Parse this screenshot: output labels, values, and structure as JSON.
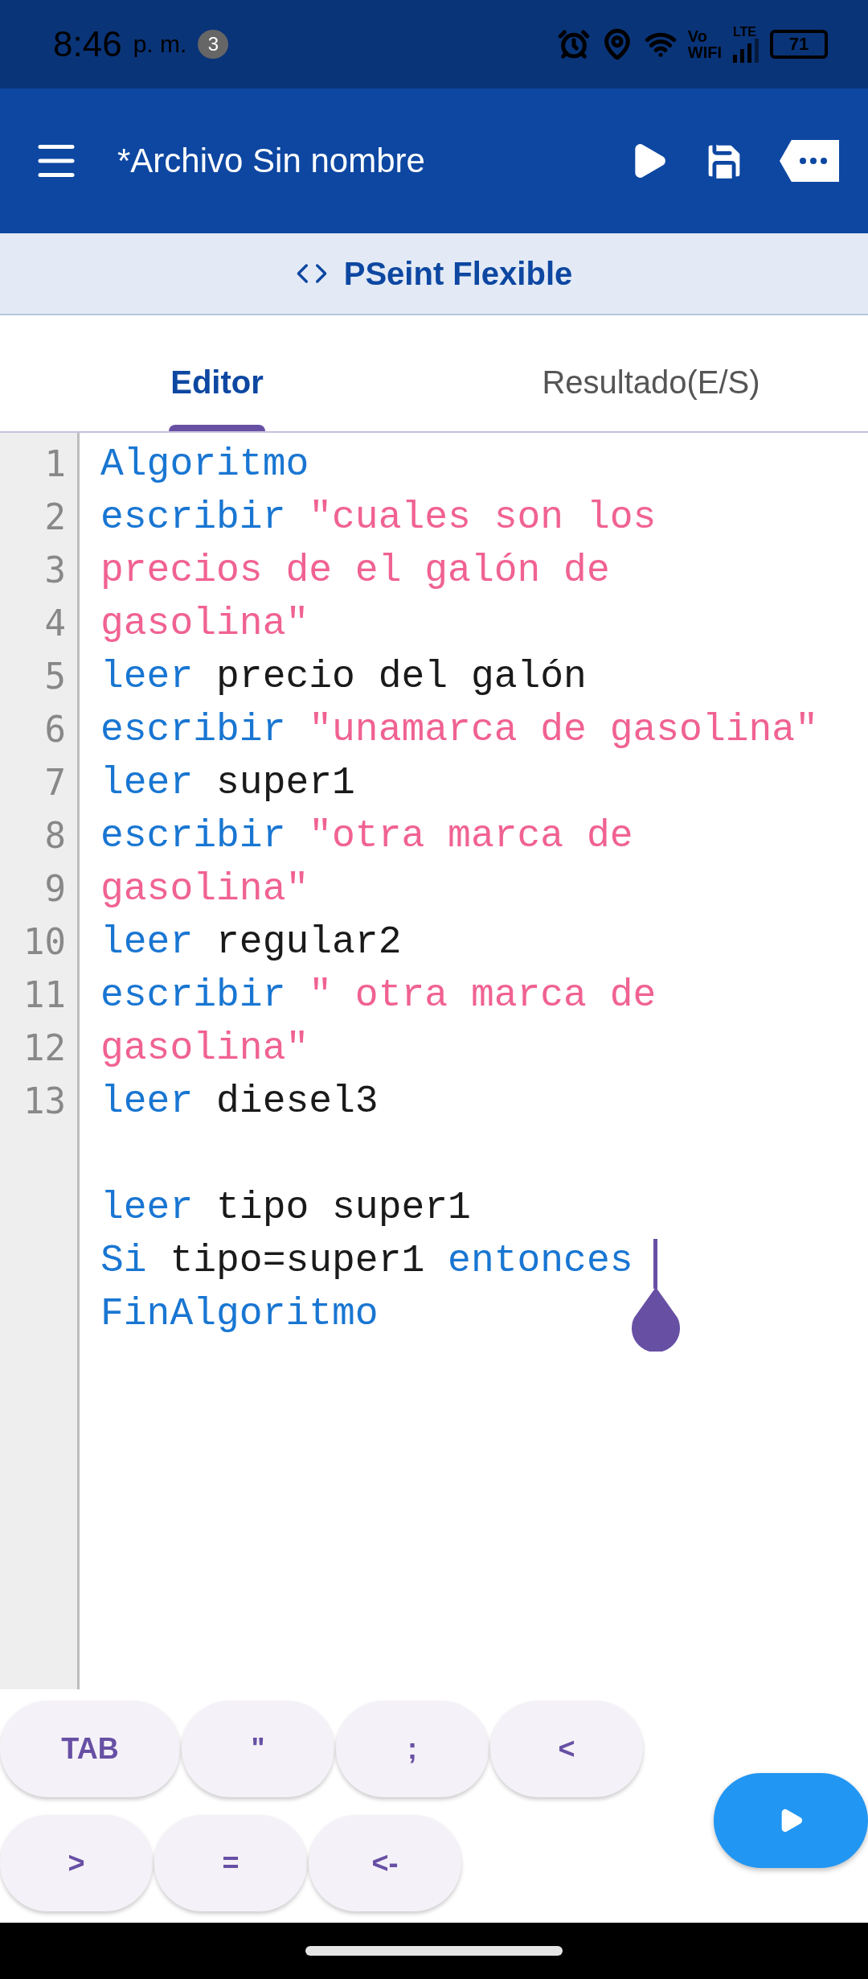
{
  "status_bar": {
    "time": "8:46",
    "period": "p. m.",
    "badge": "3",
    "vo": "Vo",
    "wifi": "WIFI",
    "network": "LTE",
    "battery": "71"
  },
  "app_bar": {
    "title": "*Archivo Sin nombre"
  },
  "subtitle": "PSeint Flexible",
  "tabs": [
    {
      "label": "Editor",
      "selected": true
    },
    {
      "label": "Resultado(E/S)",
      "selected": false
    }
  ],
  "editor": {
    "rows": [
      {
        "number": "1",
        "parts": [
          {
            "kind": "keyword",
            "text": "Algoritmo"
          }
        ]
      },
      {
        "number": "2",
        "parts": [
          {
            "kind": "keyword",
            "text": "escribir"
          },
          {
            "kind": "string",
            "text": " \"cuales son los"
          }
        ]
      },
      {
        "number": "3",
        "parts": [
          {
            "kind": "string",
            "text": "precios de el galón de"
          }
        ]
      },
      {
        "number": "4",
        "parts": [
          {
            "kind": "string",
            "text": "gasolina\""
          }
        ]
      },
      {
        "number": "5",
        "parts": [
          {
            "kind": "keyword",
            "text": "leer"
          },
          {
            "kind": "plain",
            "text": " precio del galón"
          }
        ]
      },
      {
        "number": "6",
        "parts": [
          {
            "kind": "keyword",
            "text": "escribir"
          },
          {
            "kind": "string",
            "text": " \"unamarca de gasolina\""
          }
        ]
      },
      {
        "number": "7",
        "parts": [
          {
            "kind": "keyword",
            "text": "leer"
          },
          {
            "kind": "plain",
            "text": " super1"
          }
        ]
      },
      {
        "number": "8",
        "parts": [
          {
            "kind": "keyword",
            "text": "escribir"
          },
          {
            "kind": "string",
            "text": " \"otra marca de"
          }
        ]
      },
      {
        "number": "9",
        "parts": [
          {
            "kind": "string",
            "text": "gasolina\""
          }
        ]
      },
      {
        "number": "10",
        "parts": [
          {
            "kind": "keyword",
            "text": "leer"
          },
          {
            "kind": "plain",
            "text": " regular2"
          }
        ]
      },
      {
        "number": "11",
        "parts": [
          {
            "kind": "keyword",
            "text": "escribir"
          },
          {
            "kind": "string",
            "text": " \" otra marca de"
          }
        ]
      },
      {
        "number": "12",
        "parts": [
          {
            "kind": "string",
            "text": "gasolina\""
          }
        ]
      },
      {
        "number": "13",
        "parts": [
          {
            "kind": "keyword",
            "text": "leer"
          },
          {
            "kind": "plain",
            "text": " diesel3"
          }
        ]
      },
      {
        "parts": []
      },
      {
        "parts": [
          {
            "kind": "keyword",
            "text": "leer"
          },
          {
            "kind": "plain",
            "text": " tipo super1"
          }
        ]
      },
      {
        "parts": [
          {
            "kind": "keyword",
            "text": "Si"
          },
          {
            "kind": "plain",
            "text": " tipo=super1 "
          },
          {
            "kind": "keyword",
            "text": "entonces "
          }
        ],
        "cursor": true
      },
      {
        "parts": [
          {
            "kind": "keyword",
            "text": "FinAlgoritmo"
          }
        ]
      }
    ]
  },
  "keys": [
    [
      "TAB",
      "\"",
      ";",
      "<"
    ],
    [
      ">",
      "=",
      "<-"
    ]
  ]
}
